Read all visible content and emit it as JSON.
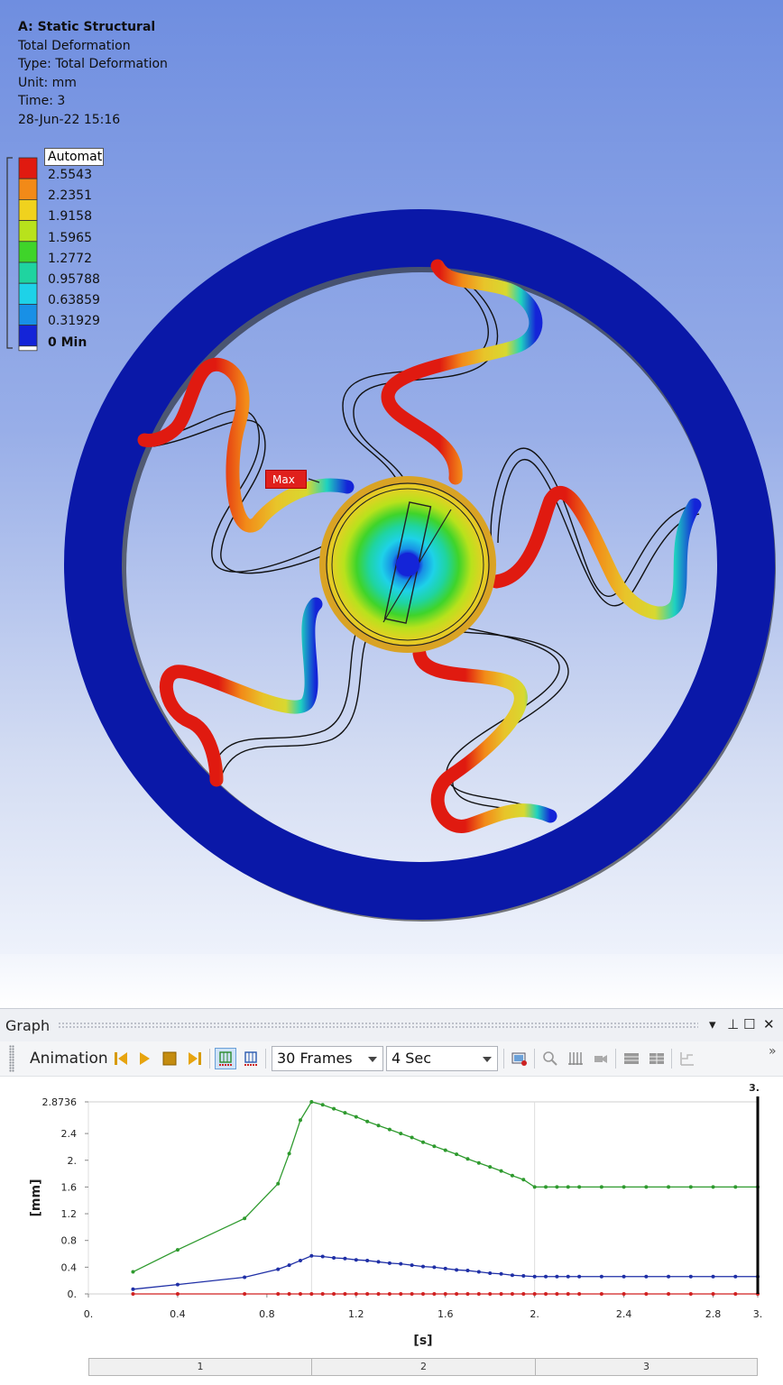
{
  "result_info": {
    "system": "A: Static Structural",
    "result_name": "Total Deformation",
    "type_line": "Type: Total Deformation",
    "unit_line": "Unit: mm",
    "time_line": "Time: 3",
    "timestamp": "28-Jun-22 15:16"
  },
  "legend": {
    "title": "Automatic",
    "labels": [
      "2.5543",
      "2.2351",
      "1.9158",
      "1.5965",
      "1.2772",
      "0.95788",
      "0.63859",
      "0.31929",
      "0 Min"
    ],
    "colors": [
      "#e01a10",
      "#f28a18",
      "#f0d21e",
      "#b8e21c",
      "#3fd42a",
      "#1fd4a0",
      "#1ed2e8",
      "#1890e6",
      "#1424d8"
    ]
  },
  "probe": {
    "max_label": "Max"
  },
  "graph_panel": {
    "title": "Graph",
    "controls": {
      "menu": "▾",
      "pin": "⊥",
      "maximize": "☐",
      "close": "✕"
    },
    "toolbar": {
      "animation_label": "Animation",
      "frames": "30 Frames",
      "duration": "4 Sec",
      "overflow": "»"
    }
  },
  "chart_data": {
    "type": "line",
    "xlabel": "[s]",
    "ylabel": "[mm]",
    "xlim": [
      0,
      3
    ],
    "ylim": [
      0,
      2.8736
    ],
    "x_ticks": [
      "0.",
      "0.4",
      "0.8",
      "1.2",
      "1.6",
      "2.",
      "2.4",
      "2.8",
      "3."
    ],
    "x_tick_values": [
      0,
      0.4,
      0.8,
      1.2,
      1.6,
      2,
      2.4,
      2.8,
      3
    ],
    "y_ticks": [
      "0.",
      "0.4",
      "0.8",
      "1.2",
      "1.6",
      "2.",
      "2.4",
      "2.8736"
    ],
    "y_tick_values": [
      0,
      0.4,
      0.8,
      1.2,
      1.6,
      2.0,
      2.4,
      2.8736
    ],
    "current_time_marker": "3.",
    "current_time": 3,
    "step_boundaries": [
      0,
      1,
      2,
      3
    ],
    "steps": [
      "1",
      "2",
      "3"
    ],
    "series": [
      {
        "color": "#2e9a2e",
        "x": [
          0.2,
          0.4,
          0.7,
          0.85,
          0.9,
          0.95,
          1.0,
          1.05,
          1.1,
          1.15,
          1.2,
          1.25,
          1.3,
          1.35,
          1.4,
          1.45,
          1.5,
          1.55,
          1.6,
          1.65,
          1.7,
          1.75,
          1.8,
          1.85,
          1.9,
          1.95,
          2.0,
          2.05,
          2.1,
          2.15,
          2.2,
          2.3,
          2.4,
          2.5,
          2.6,
          2.7,
          2.8,
          2.9,
          3.0
        ],
        "y": [
          0.33,
          0.66,
          1.13,
          1.65,
          2.1,
          2.6,
          2.8736,
          2.83,
          2.77,
          2.71,
          2.65,
          2.58,
          2.52,
          2.46,
          2.4,
          2.34,
          2.27,
          2.21,
          2.15,
          2.09,
          2.02,
          1.96,
          1.9,
          1.84,
          1.77,
          1.71,
          1.6,
          1.6,
          1.6,
          1.6,
          1.6,
          1.6,
          1.6,
          1.6,
          1.6,
          1.6,
          1.6,
          1.6,
          1.6
        ]
      },
      {
        "color": "#1f2fa6",
        "x": [
          0.2,
          0.4,
          0.7,
          0.85,
          0.9,
          0.95,
          1.0,
          1.05,
          1.1,
          1.15,
          1.2,
          1.25,
          1.3,
          1.35,
          1.4,
          1.45,
          1.5,
          1.55,
          1.6,
          1.65,
          1.7,
          1.75,
          1.8,
          1.85,
          1.9,
          1.95,
          2.0,
          2.05,
          2.1,
          2.15,
          2.2,
          2.3,
          2.4,
          2.5,
          2.6,
          2.7,
          2.8,
          2.9,
          3.0
        ],
        "y": [
          0.07,
          0.14,
          0.25,
          0.37,
          0.43,
          0.5,
          0.57,
          0.56,
          0.54,
          0.53,
          0.51,
          0.5,
          0.48,
          0.46,
          0.45,
          0.43,
          0.41,
          0.4,
          0.38,
          0.36,
          0.35,
          0.33,
          0.31,
          0.3,
          0.28,
          0.27,
          0.26,
          0.26,
          0.26,
          0.26,
          0.26,
          0.26,
          0.26,
          0.26,
          0.26,
          0.26,
          0.26,
          0.26,
          0.26
        ]
      },
      {
        "color": "#d02020",
        "x": [
          0.2,
          0.4,
          0.7,
          0.85,
          0.9,
          0.95,
          1.0,
          1.05,
          1.1,
          1.15,
          1.2,
          1.25,
          1.3,
          1.35,
          1.4,
          1.45,
          1.5,
          1.55,
          1.6,
          1.65,
          1.7,
          1.75,
          1.8,
          1.85,
          1.9,
          1.95,
          2.0,
          2.05,
          2.1,
          2.15,
          2.2,
          2.3,
          2.4,
          2.5,
          2.6,
          2.7,
          2.8,
          2.9,
          3.0
        ],
        "y": [
          0,
          0,
          0,
          0,
          0,
          0,
          0,
          0,
          0,
          0,
          0,
          0,
          0,
          0,
          0,
          0,
          0,
          0,
          0,
          0,
          0,
          0,
          0,
          0,
          0,
          0,
          0,
          0,
          0,
          0,
          0,
          0,
          0,
          0,
          0,
          0,
          0,
          0,
          0
        ]
      }
    ]
  }
}
